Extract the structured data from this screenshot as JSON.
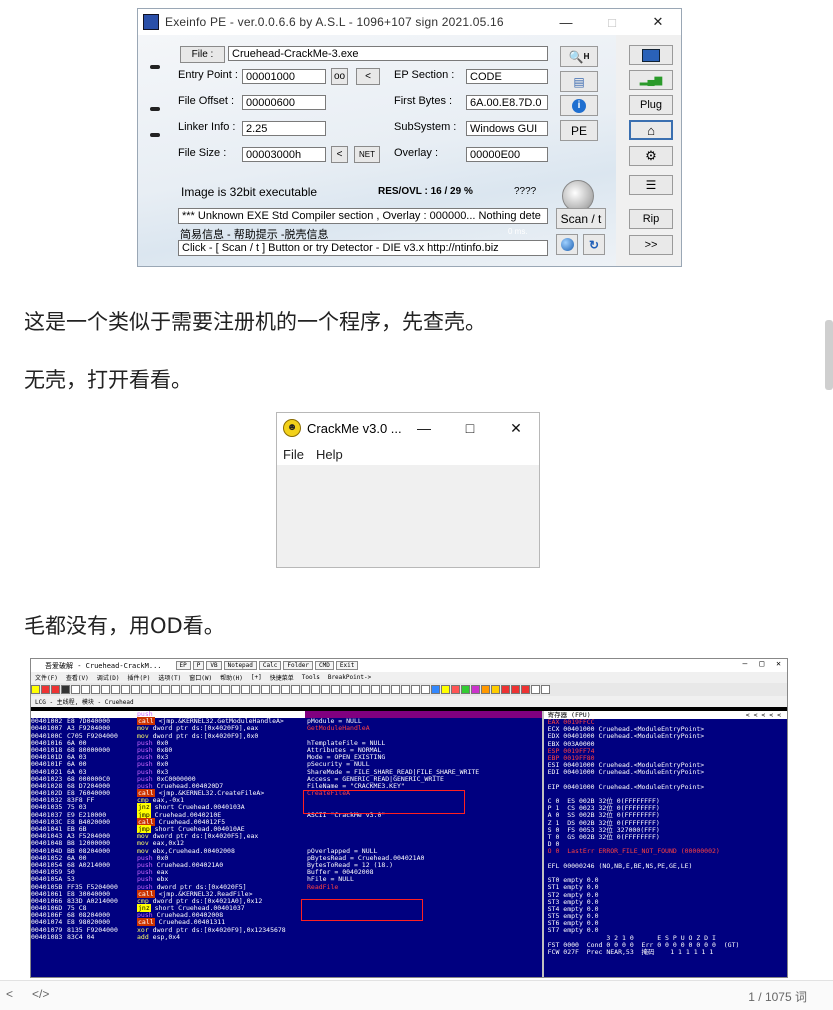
{
  "exeinfo": {
    "title": "Exeinfo PE - ver.0.0.6.6  by A.S.L -  1096+107 sign  2021.05.16",
    "file_button": "File :",
    "file_value": "Cruehead-CrackMe-3.exe",
    "labels": {
      "entry_point": "Entry Point :",
      "ep_section": "EP Section :",
      "file_offset": "File Offset :",
      "first_bytes": "First Bytes :",
      "linker_info": "Linker Info :",
      "subsystem": "SubSystem :",
      "file_size": "File Size :",
      "overlay": "Overlay :"
    },
    "values": {
      "entry_point": "00001000",
      "ep_section": "CODE",
      "file_offset": "00000600",
      "first_bytes": "6A.00.E8.7D.0",
      "linker_info": "2.25",
      "subsystem": "Windows GUI",
      "file_size": "00003000h",
      "overlay": "00000E00"
    },
    "buttons": {
      "oo": "oo",
      "lt": "<",
      "lt2": "<",
      "net": "NET",
      "h": "H",
      "pe": "PE",
      "scan": "Scan / t",
      "plug": "Plug",
      "rip": "Rip",
      "next": ">>"
    },
    "status": {
      "image": "Image is 32bit executable",
      "res_ovl": "RES/OVL : 16 / 29 %",
      "qq": "????",
      "result": "*** Unknown EXE  Std Compiler section  , Overlay : 000000... Nothing dete",
      "hint": "简易信息 - 帮助提示 -脱壳信息",
      "ms": "0 ms.",
      "click": "Click - [ Scan / t ]  Button  or  try Detector - DIE v3.x  http://ntinfo.biz"
    }
  },
  "article": {
    "p1": "这是一个类似于需要注册机的一个程序，先查壳。",
    "p2": "无壳，打开看看。",
    "p3": "毛都没有，用OD看。"
  },
  "crackme": {
    "title": "CrackMe v3.0  ...",
    "menu": [
      "File",
      "Help"
    ]
  },
  "od": {
    "title": "吾爱破解 - Cruehead-CrackM...",
    "tabs": [
      "EP",
      "P",
      "VB",
      "Notepad",
      "Calc",
      "Folder",
      "CMD",
      "Exit"
    ],
    "menu": [
      "文件(F)",
      "查看(V)",
      "调试(D)",
      "插件(P)",
      "选项(T)",
      "窗口(W)",
      "帮助(H)",
      "[+]",
      "快捷菜单",
      "Tools",
      "BreakPoint->"
    ],
    "status": "LCG - 主线程, 模块 - Cruehead",
    "code_rows": [
      {
        "addr": "00401000",
        "hex": "6A 00",
        "op": "push",
        "arg": "0x0",
        "cmt": ""
      },
      {
        "addr": "00401002",
        "hex": "E8 7D040000",
        "op": "call",
        "arg": "<jmp.&KERNEL32.GetModuleHandleA>",
        "cmt": "pModule = NULL"
      },
      {
        "addr": "00401007",
        "hex": "A3 F9204000",
        "op": "mov",
        "arg": "dword ptr ds:[0x4020F9],eax",
        "cmt": "GetModuleHandleA"
      },
      {
        "addr": "0040100C",
        "hex": "C705 F9204000",
        "op": "mov",
        "arg": "dword ptr ds:[0x4020F9],0x0",
        "cmt": ""
      },
      {
        "addr": "00401016",
        "hex": "6A 00",
        "op": "push",
        "arg": "0x0",
        "cmt": "hTemplateFile = NULL"
      },
      {
        "addr": "00401018",
        "hex": "68 80000000",
        "op": "push",
        "arg": "0x80",
        "cmt": "Attributes = NORMAL"
      },
      {
        "addr": "0040101D",
        "hex": "6A 03",
        "op": "push",
        "arg": "0x3",
        "cmt": "Mode = OPEN_EXISTING"
      },
      {
        "addr": "0040101F",
        "hex": "6A 00",
        "op": "push",
        "arg": "0x0",
        "cmt": "pSecurity = NULL"
      },
      {
        "addr": "00401021",
        "hex": "6A 03",
        "op": "push",
        "arg": "0x3",
        "cmt": "ShareMode = FILE_SHARE_READ|FILE_SHARE_WRITE"
      },
      {
        "addr": "00401023",
        "hex": "68 000000C0",
        "op": "push",
        "arg": "0xC0000000",
        "cmt": "Access = GENERIC_READ|GENERIC_WRITE"
      },
      {
        "addr": "00401028",
        "hex": "68 D7204000",
        "op": "push",
        "arg": "Cruehead.004020D7",
        "cmt": "FileName = \"CRACKME3.KEY\""
      },
      {
        "addr": "0040102D",
        "hex": "E8 76040000",
        "op": "call",
        "arg": "<jmp.&KERNEL32.CreateFileA>",
        "cmt": "CreateFileA"
      },
      {
        "addr": "00401032",
        "hex": "83F8 FF",
        "op": "cmp",
        "arg": "eax,-0x1",
        "cmt": ""
      },
      {
        "addr": "00401035",
        "hex": "75 03",
        "op": "jnz",
        "arg": "short Cruehead.0040103A",
        "cmt": ""
      },
      {
        "addr": "00401037",
        "hex": "E9 E210000",
        "op": "jmp",
        "arg": "Cruehead.0040210E",
        "cmt": "ASCII \"CrackMe v3.0\""
      },
      {
        "addr": "0040103C",
        "hex": "E8 B4020000",
        "op": "call",
        "arg": "Cruehead.004012F5",
        "cmt": ""
      },
      {
        "addr": "00401041",
        "hex": "EB 6B",
        "op": "jmp",
        "arg": "short Cruehead.004010AE",
        "cmt": ""
      },
      {
        "addr": "00401043",
        "hex": "A3 F5204000",
        "op": "mov",
        "arg": "dword ptr ds:[0x4020F5],eax",
        "cmt": ""
      },
      {
        "addr": "00401048",
        "hex": "B8 12000000",
        "op": "mov",
        "arg": "eax,0x12",
        "cmt": ""
      },
      {
        "addr": "0040104D",
        "hex": "BB 08204000",
        "op": "mov",
        "arg": "ebx,Cruehead.00402008",
        "cmt": "pOverlapped = NULL"
      },
      {
        "addr": "00401052",
        "hex": "6A 00",
        "op": "push",
        "arg": "0x0",
        "cmt": "pBytesRead = Cruehead.004021A0"
      },
      {
        "addr": "00401054",
        "hex": "68 A0214000",
        "op": "push",
        "arg": "Cruehead.004021A0",
        "cmt": "BytesToRead = 12 (18.)"
      },
      {
        "addr": "00401059",
        "hex": "50",
        "op": "push",
        "arg": "eax",
        "cmt": "Buffer = 00402008"
      },
      {
        "addr": "0040105A",
        "hex": "53",
        "op": "push",
        "arg": "ebx",
        "cmt": "hFile = NULL"
      },
      {
        "addr": "0040105B",
        "hex": "FF35 F5204000",
        "op": "push",
        "arg": "dword ptr ds:[0x4020F5]",
        "cmt": "ReadFile"
      },
      {
        "addr": "00401061",
        "hex": "E8 30040000",
        "op": "call",
        "arg": "<jmp.&KERNEL32.ReadFile>",
        "cmt": ""
      },
      {
        "addr": "00401066",
        "hex": "833D A0214000",
        "op": "cmp",
        "arg": "dword ptr ds:[0x4021A0],0x12",
        "cmt": ""
      },
      {
        "addr": "0040106D",
        "hex": "75 C8",
        "op": "jnz",
        "arg": "short Cruehead.00401037",
        "cmt": ""
      },
      {
        "addr": "0040106F",
        "hex": "68 08204000",
        "op": "push",
        "arg": "Cruehead.00402008",
        "cmt": ""
      },
      {
        "addr": "00401074",
        "hex": "E8 98020000",
        "op": "call",
        "arg": "Cruehead.00401311",
        "cmt": ""
      },
      {
        "addr": "00401079",
        "hex": "8135 F9204000",
        "op": "xor",
        "arg": "dword ptr ds:[0x4020F9],0x12345678",
        "cmt": ""
      },
      {
        "addr": "00401083",
        "hex": "83C4 04",
        "op": "add",
        "arg": "esp,0x4",
        "cmt": ""
      }
    ],
    "regs_title": "寄存器 (FPU)",
    "reg_rows": [
      "EAX 0019FFCC",
      "ECX 00401000 Cruehead.<ModuleEntryPoint>",
      "EDX 00401000 Cruehead.<ModuleEntryPoint>",
      "EBX 003A0000",
      "ESP 0019FF74",
      "EBP 0019FF80",
      "ESI 00401000 Cruehead.<ModuleEntryPoint>",
      "EDI 00401000 Cruehead.<ModuleEntryPoint>",
      "",
      "EIP 00401000 Cruehead.<ModuleEntryPoint>",
      "",
      "C 0  ES 002B 32位 0(FFFFFFFF)",
      "P 1  CS 0023 32位 0(FFFFFFFF)",
      "A 0  SS 002B 32位 0(FFFFFFFF)",
      "Z 1  DS 002B 32位 0(FFFFFFFF)",
      "S 0  FS 0053 32位 327000(FFF)",
      "T 0  GS 002B 32位 0(FFFFFFFF)",
      "D 0",
      "O 0  LastErr ERROR_FILE_NOT_FOUND (00000002)",
      "",
      "EFL 00000246 (NO,NB,E,BE,NS,PE,GE,LE)",
      "",
      "ST0 empty 0.0",
      "ST1 empty 0.0",
      "ST2 empty 0.0",
      "ST3 empty 0.0",
      "ST4 empty 0.0",
      "ST5 empty 0.0",
      "ST6 empty 0.0",
      "ST7 empty 0.0",
      "               3 2 1 0      E S P U O Z D I",
      "FST 0000  Cond 0 0 0 0  Err 0 0 0 0 0 0 0 0  (GT)",
      "FCW 027F  Prec NEAR,53  掩码    1 1 1 1 1 1"
    ]
  },
  "bottom": {
    "left_icon": "<",
    "code_icon": "</>",
    "word_count": "1 / 1075 词"
  },
  "colors": {
    "od_code_bg": "#000080",
    "call_bg": "#cc3300",
    "red_box": "#ff2020"
  }
}
